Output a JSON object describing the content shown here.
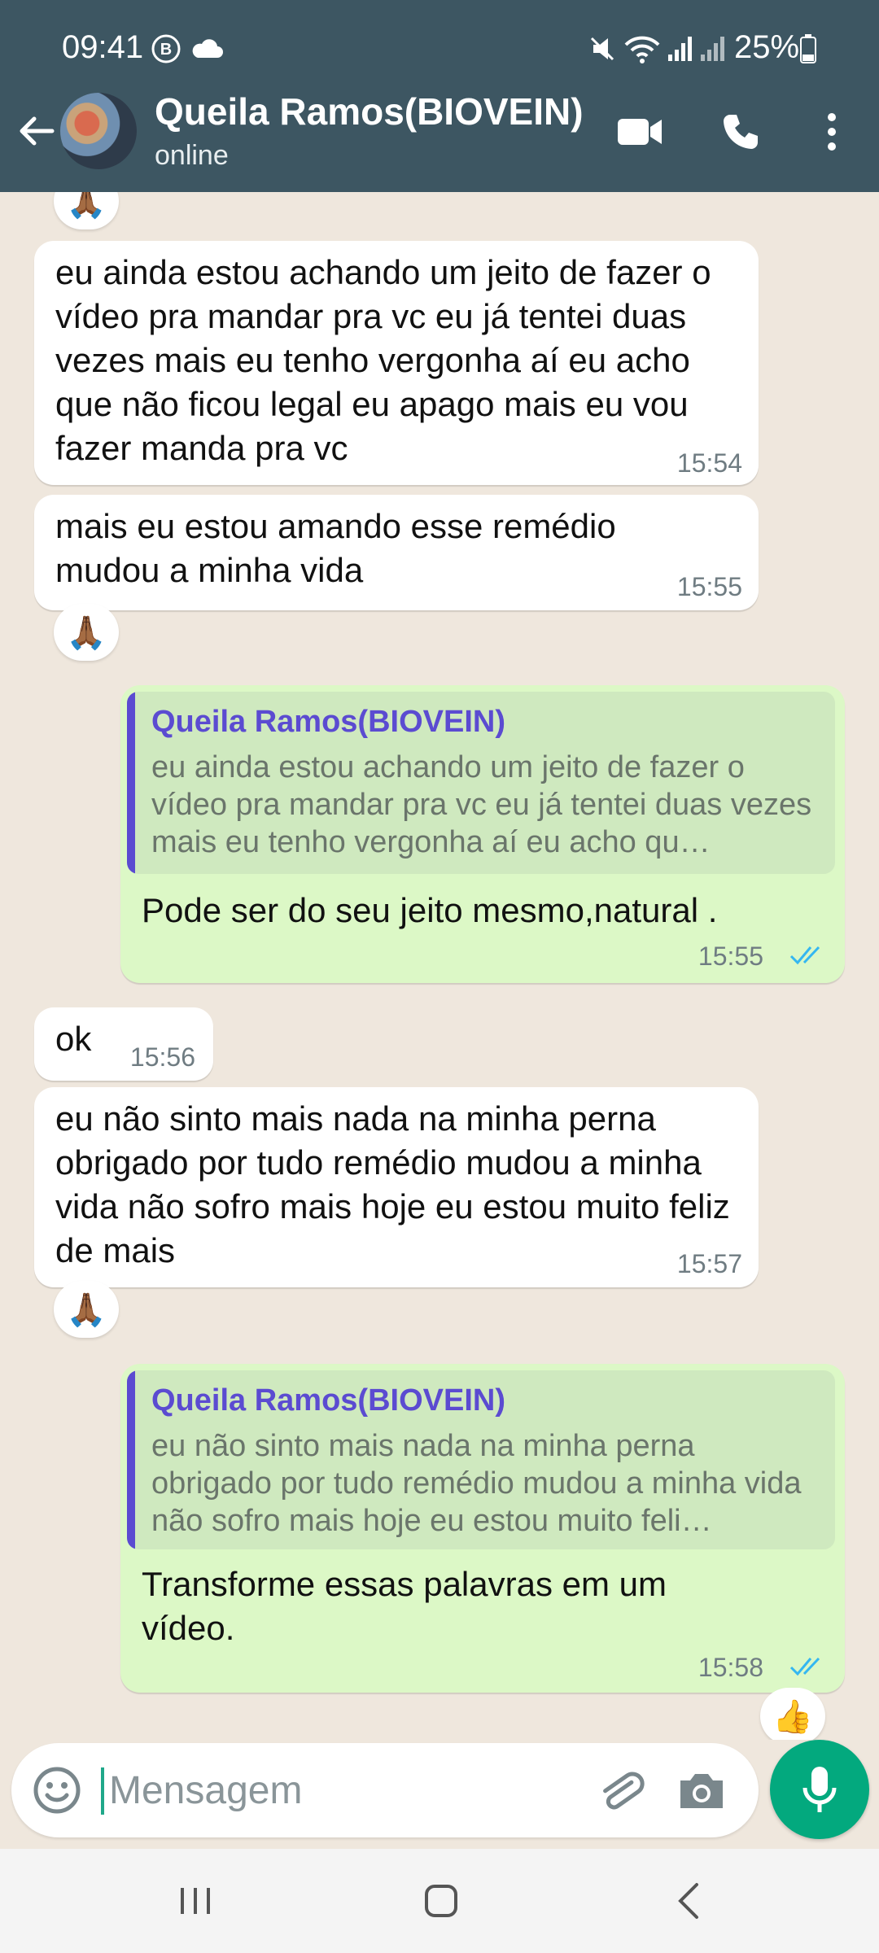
{
  "status_bar": {
    "time": "09:41",
    "battery": "25%",
    "icons": [
      "b-notification-icon",
      "cloud-icon",
      "mute-icon",
      "wifi-icon",
      "signal-icon",
      "signal-icon-2",
      "battery-icon"
    ]
  },
  "header": {
    "contact_name": "Queila Ramos(BIOVEIN)",
    "contact_status": "online",
    "actions": [
      "video-call-icon",
      "voice-call-icon",
      "more-options-icon"
    ],
    "background_color": "#3d5662"
  },
  "messages": [
    {
      "direction": "in",
      "text": "eu ainda estou achando um jeito de fazer o vídeo pra mandar pra vc eu já tentei duas vezes mais eu tenho vergonha aí eu acho que não ficou legal eu apago mais eu vou fazer manda pra vc",
      "time": "15:54"
    },
    {
      "direction": "in",
      "text": "mais eu estou amando esse remédio mudou a minha vida",
      "time": "15:55",
      "reaction": "🙏🏾"
    },
    {
      "direction": "out",
      "quote_author": "Queila Ramos(BIOVEIN)",
      "quote_text": "eu ainda estou achando um jeito de fazer o vídeo pra mandar pra vc eu já tentei duas vezes mais eu tenho vergonha aí eu acho qu…",
      "text": "Pode ser do seu jeito mesmo,natural .",
      "time": "15:55",
      "status": "read"
    },
    {
      "direction": "in",
      "text": "ok",
      "time": "15:56"
    },
    {
      "direction": "in",
      "text": "eu não sinto mais nada na minha perna obrigado por tudo remédio mudou a minha vida não sofro mais hoje eu estou muito feliz de mais",
      "time": "15:57",
      "reaction": "🙏🏾"
    },
    {
      "direction": "out",
      "quote_author": "Queila Ramos(BIOVEIN)",
      "quote_text": "eu não sinto mais nada na minha perna obrigado por tudo remédio mudou a minha vida não sofro mais hoje eu estou muito feli…",
      "text": "Transforme essas palavras em um vídeo.",
      "time": "15:58",
      "status": "read",
      "reaction": "👍"
    }
  ],
  "top_reaction": "🙏🏾",
  "input": {
    "placeholder": "Mensagem",
    "value": ""
  },
  "colors": {
    "incoming_bubble": "#ffffff",
    "outgoing_bubble": "#dcf8c6",
    "quote_accent": "#5b4bd1",
    "read_ticks": "#34b7f1",
    "mic_button": "#03a97e",
    "chat_background": "#efe7dd"
  }
}
